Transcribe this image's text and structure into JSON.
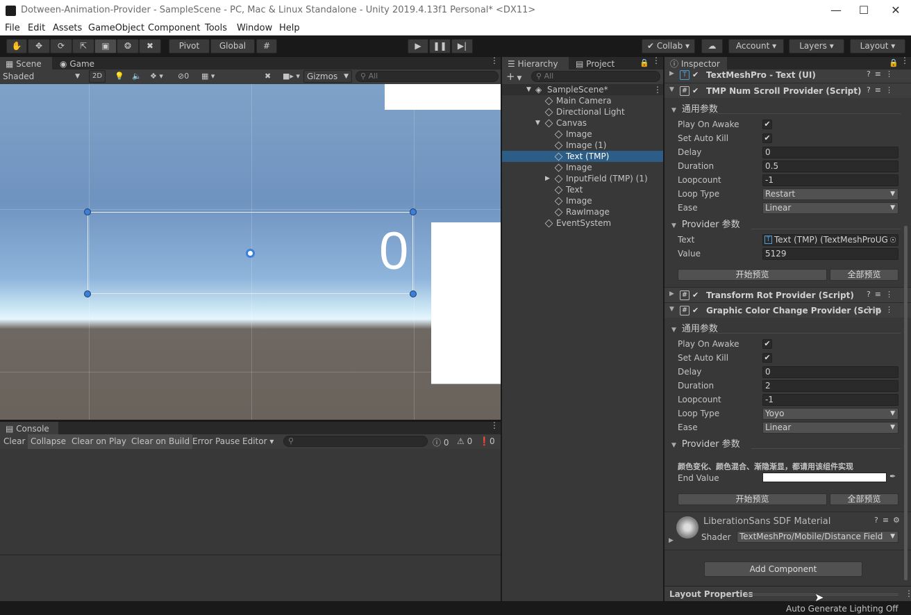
{
  "window": {
    "title": "Dotween-Animation-Provider - SampleScene - PC, Mac & Linux Standalone - Unity 2019.4.13f1 Personal* <DX11>"
  },
  "menu": [
    "File",
    "Edit",
    "Assets",
    "GameObject",
    "Component",
    "Tools",
    "Window",
    "Help"
  ],
  "toolbar": {
    "pivot": "Pivot",
    "global": "Global",
    "collab": "Collab",
    "account": "Account",
    "layers": "Layers",
    "layout": "Layout"
  },
  "scene": {
    "tabs": [
      "Scene",
      "Game"
    ],
    "shading": "Shaded",
    "mode_2d": "2D",
    "hidden_count": "0",
    "gizmos": "Gizmos",
    "search_placeholder": "All",
    "text_value": "0"
  },
  "console": {
    "tab": "Console",
    "buttons": [
      "Clear",
      "Collapse",
      "Clear on Play",
      "Clear on Build",
      "Error Pause",
      "Editor"
    ],
    "counts": {
      "info": "0",
      "warn": "0",
      "error": "0"
    }
  },
  "hierarchy": {
    "tabs": [
      "Hierarchy",
      "Project"
    ],
    "search_placeholder": "All",
    "scene_name": "SampleScene*",
    "items": [
      {
        "label": "Main Camera",
        "indent": 1
      },
      {
        "label": "Directional Light",
        "indent": 1
      },
      {
        "label": "Canvas",
        "indent": 1,
        "expanded": true
      },
      {
        "label": "Image",
        "indent": 2
      },
      {
        "label": "Image (1)",
        "indent": 2
      },
      {
        "label": "Text (TMP)",
        "indent": 2,
        "selected": true
      },
      {
        "label": "Image",
        "indent": 2
      },
      {
        "label": "InputField (TMP) (1)",
        "indent": 2,
        "collapsed": true
      },
      {
        "label": "Text",
        "indent": 2
      },
      {
        "label": "Image",
        "indent": 2
      },
      {
        "label": "RawImage",
        "indent": 2
      },
      {
        "label": "EventSystem",
        "indent": 1
      }
    ]
  },
  "inspector": {
    "tab": "Inspector",
    "textmeshpro_header": "TextMeshPro - Text (UI)",
    "tmp_scroll": {
      "title": "TMP Num Scroll Provider (Script)",
      "section_general": "通用参数",
      "play_on_awake_label": "Play On Awake",
      "set_auto_kill_label": "Set Auto Kill",
      "delay_label": "Delay",
      "delay": "0",
      "duration_label": "Duration",
      "duration": "0.5",
      "loopcount_label": "Loopcount",
      "loopcount": "-1",
      "loop_type_label": "Loop Type",
      "loop_type": "Restart",
      "ease_label": "Ease",
      "ease": "Linear",
      "section_provider": "Provider 参数",
      "text_label": "Text",
      "text_ref": "Text (TMP) (TextMeshProUG",
      "value_label": "Value",
      "value": "5129",
      "start_preview": "开始预览",
      "all_preview": "全部预览"
    },
    "transform_rot": {
      "title": "Transform Rot Provider (Script)"
    },
    "graphic_color": {
      "title": "Graphic Color Change Provider (Scrip",
      "section_general": "通用参数",
      "play_on_awake_label": "Play On Awake",
      "set_auto_kill_label": "Set Auto Kill",
      "delay_label": "Delay",
      "delay": "0",
      "duration_label": "Duration",
      "duration": "2",
      "loopcount_label": "Loopcount",
      "loopcount": "-1",
      "loop_type_label": "Loop Type",
      "loop_type": "Yoyo",
      "ease_label": "Ease",
      "ease": "Linear",
      "section_provider": "Provider 参数",
      "note": "颜色变化、颜色混合、渐隐渐显，都请用该组件实现",
      "end_value_label": "End Value",
      "end_value_color": "#ffffff",
      "start_preview": "开始预览",
      "all_preview": "全部预览"
    },
    "material": {
      "name": "LiberationSans SDF Material",
      "shader_label": "Shader",
      "shader": "TextMeshPro/Mobile/Distance Field"
    },
    "add_component": "Add Component",
    "layout_properties": "Layout Properties"
  },
  "status": {
    "text": "Auto Generate Lighting Off"
  }
}
